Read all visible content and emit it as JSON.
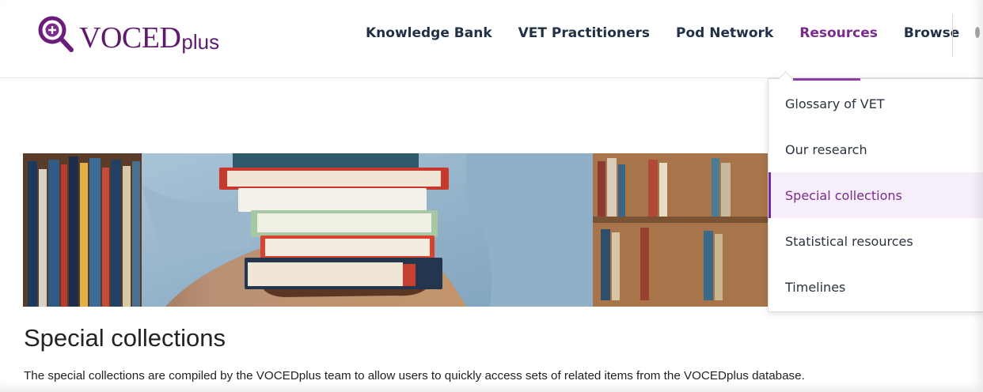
{
  "header": {
    "logo": {
      "main": "VOCED",
      "suffix": "plus",
      "icon": "magnifier-plus-icon",
      "color": "#5e1a6e"
    },
    "nav": [
      {
        "label": "Knowledge Bank",
        "active": false
      },
      {
        "label": "VET Practitioners",
        "active": false
      },
      {
        "label": "Pod Network",
        "active": false
      },
      {
        "label": "Resources",
        "active": true
      },
      {
        "label": "Browse",
        "active": false
      }
    ],
    "active_color": "#7b2a8e",
    "text_color": "#1f3047"
  },
  "dropdown": {
    "items": [
      {
        "label": "Glossary of VET",
        "active": false
      },
      {
        "label": "Our research",
        "active": false
      },
      {
        "label": "Special collections",
        "active": true
      },
      {
        "label": "Statistical resources",
        "active": false
      },
      {
        "label": "Timelines",
        "active": false
      }
    ],
    "highlight_bg": "#f6eef9",
    "accent": "#8a3fa1"
  },
  "main": {
    "hero_image": "books-stack-library-photo",
    "title": "Special collections",
    "intro": "The special collections are compiled by the VOCEDplus team to allow users to quickly access sets of related items from the VOCEDplus database."
  }
}
